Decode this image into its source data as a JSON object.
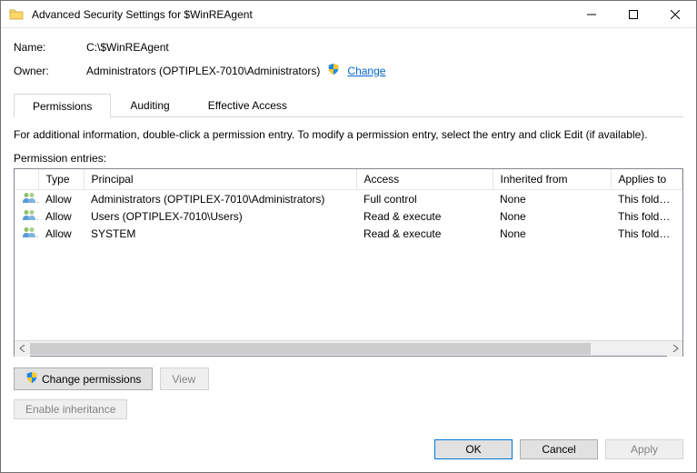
{
  "window": {
    "title": "Advanced Security Settings for $WinREAgent"
  },
  "header": {
    "name_label": "Name:",
    "name_value": "C:\\$WinREAgent",
    "owner_label": "Owner:",
    "owner_value": "Administrators (OPTIPLEX-7010\\Administrators)",
    "change_link": "Change"
  },
  "tabs": {
    "permissions": "Permissions",
    "auditing": "Auditing",
    "effective_access": "Effective Access"
  },
  "body": {
    "info_text": "For additional information, double-click a permission entry. To modify a permission entry, select the entry and click Edit (if available).",
    "entries_label": "Permission entries:"
  },
  "columns": {
    "type": "Type",
    "principal": "Principal",
    "access": "Access",
    "inherited": "Inherited from",
    "applies": "Applies to"
  },
  "entries": [
    {
      "type": "Allow",
      "principal": "Administrators (OPTIPLEX-7010\\Administrators)",
      "access": "Full control",
      "inherited": "None",
      "applies": "This folder, subfolders and files"
    },
    {
      "type": "Allow",
      "principal": "Users (OPTIPLEX-7010\\Users)",
      "access": "Read & execute",
      "inherited": "None",
      "applies": "This folder, subfolders and files"
    },
    {
      "type": "Allow",
      "principal": "SYSTEM",
      "access": "Read & execute",
      "inherited": "None",
      "applies": "This folder, subfolders and files"
    }
  ],
  "buttons": {
    "change_permissions": "Change permissions",
    "view": "View",
    "enable_inheritance": "Enable inheritance",
    "ok": "OK",
    "cancel": "Cancel",
    "apply": "Apply"
  }
}
